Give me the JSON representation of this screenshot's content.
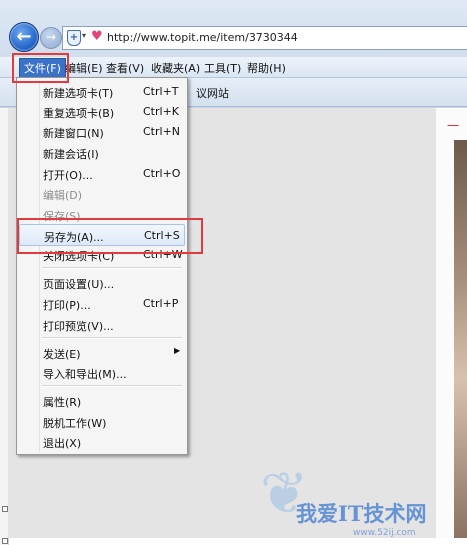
{
  "address": {
    "url": "http://www.topit.me/item/3730344",
    "back_glyph": "←",
    "forward_glyph": "→",
    "shield_glyph": "+",
    "drop_glyph": "▾",
    "heart_glyph": "♥"
  },
  "menubar": {
    "file": "文件(F)",
    "edit": "编辑(E)",
    "view": "查看(V)",
    "favorites": "收藏夹(A)",
    "tools": "工具(T)",
    "help": "帮助(H)"
  },
  "favorites_bar": {
    "suggested_sites": "议网站"
  },
  "file_menu": {
    "new_tab": {
      "label": "新建选项卡(T)",
      "shortcut": "Ctrl+T"
    },
    "duplicate_tab": {
      "label": "重复选项卡(B)",
      "shortcut": "Ctrl+K"
    },
    "new_window": {
      "label": "新建窗口(N)",
      "shortcut": "Ctrl+N"
    },
    "new_session": {
      "label": "新建会话(I)"
    },
    "open": {
      "label": "打开(O)...",
      "shortcut": "Ctrl+O"
    },
    "edit": {
      "label": "编辑(D)"
    },
    "save": {
      "label": "保存(S)"
    },
    "save_as": {
      "label": "另存为(A)...",
      "shortcut": "Ctrl+S"
    },
    "close_tab": {
      "label": "关闭选项卡(C)",
      "shortcut": "Ctrl+W"
    },
    "page_setup": {
      "label": "页面设置(U)..."
    },
    "print": {
      "label": "打印(P)...",
      "shortcut": "Ctrl+P"
    },
    "print_preview": {
      "label": "打印预览(V)..."
    },
    "send": {
      "label": "发送(E)",
      "arrow": "▶"
    },
    "import_export": {
      "label": "导入和导出(M)..."
    },
    "properties": {
      "label": "属性(R)"
    },
    "work_offline": {
      "label": "脱机工作(W)"
    },
    "exit": {
      "label": "退出(X)"
    }
  },
  "page": {
    "red_fragment": "一"
  },
  "watermark": {
    "wing_glyph": "❦",
    "title": "我爱IT技术网",
    "subtitle": "www.52ij.com"
  },
  "colors": {
    "highlight_box": "#e33b3b",
    "accent_blue": "#3a72c7"
  }
}
